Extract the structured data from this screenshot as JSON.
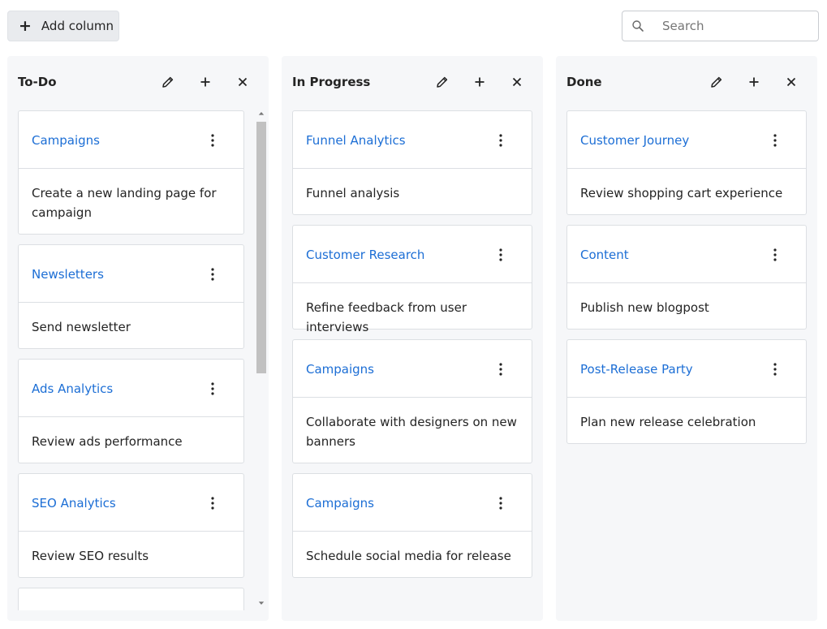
{
  "toolbar": {
    "add_column_label": "Add column",
    "search_placeholder": "Search"
  },
  "columns": [
    {
      "title": "To-Do",
      "cards": [
        {
          "title": "Campaigns",
          "text": "Create a new landing page for campaign"
        },
        {
          "title": "Newsletters",
          "text": "Send newsletter"
        },
        {
          "title": "Ads Analytics",
          "text": "Review ads performance"
        },
        {
          "title": "SEO Analytics",
          "text": "Review SEO results"
        }
      ]
    },
    {
      "title": "In Progress",
      "cards": [
        {
          "title": "Funnel Analytics",
          "text": "Funnel analysis"
        },
        {
          "title": "Customer Research",
          "text": "Refine feedback from user interviews"
        },
        {
          "title": "Campaigns",
          "text": "Collaborate with designers on new banners"
        },
        {
          "title": "Campaigns",
          "text": "Schedule social media for release"
        }
      ]
    },
    {
      "title": "Done",
      "cards": [
        {
          "title": "Customer Journey",
          "text": "Review shopping cart experience"
        },
        {
          "title": "Content",
          "text": "Publish new blogpost"
        },
        {
          "title": "Post-Release Party",
          "text": "Plan new release celebration"
        }
      ]
    }
  ],
  "icons": {
    "add": "plus-icon",
    "search": "search-icon",
    "edit": "pencil-icon",
    "close": "close-icon",
    "menu": "kebab-icon"
  },
  "colors": {
    "accent": "#1c6ed5",
    "column_bg": "#f6f7f9",
    "border": "#dcdfe3"
  }
}
